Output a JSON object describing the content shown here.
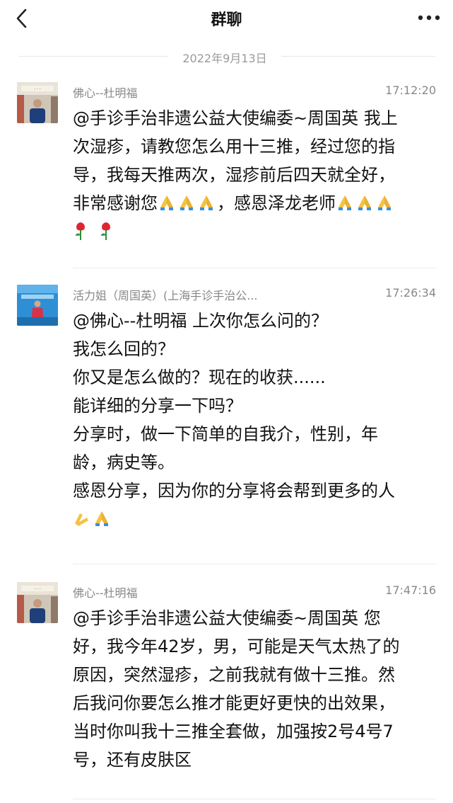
{
  "header": {
    "title": "群聊",
    "back_icon": "chevron-left-icon",
    "more_icon": "more-dots-icon"
  },
  "date_separator": "2022年9月13日",
  "messages": [
    {
      "sender": "佛心--杜明福",
      "time": "17:12:20",
      "lines": [
        "@手诊手治非遗公益大使编委~周国英 我上",
        "次湿疹，请教您怎么用十三推，经过您的指",
        "导，我每天推两次，湿疹前后四天就全好，",
        "非常感谢您",
        "，感恩泽龙老师"
      ]
    },
    {
      "sender": "活力姐（周国英）(上海手诊手治公...",
      "time": "17:26:34",
      "lines": [
        "@佛心--杜明福 上次你怎么问的？",
        "我怎么回的？",
        "你又是怎么做的？现在的收获......",
        "能详细的分享一下吗？",
        "分享时，做一下简单的自我介，性别，年",
        "龄，病史等。",
        "感恩分享，因为你的分享将会帮到更多的人"
      ]
    },
    {
      "sender": "佛心--杜明福",
      "time": "17:47:16",
      "lines": [
        "@手诊手治非遗公益大使编委~周国英 您",
        "好，我今年42岁，男，可能是天气太热了的",
        "原因，突然湿疹，之前我就有做十三推。然",
        "后我问你要怎么推才能更好更快的出效果，",
        "当时你叫我十三推全套做，加强按2号4号7",
        "号，还有皮肤区"
      ]
    }
  ],
  "emoji": {
    "hands": "folded-hands-emoji",
    "rose": "rose-emoji"
  },
  "colors": {
    "accent_text": "#111111",
    "meta_text": "#888888",
    "date_text": "#9a9a9a"
  }
}
